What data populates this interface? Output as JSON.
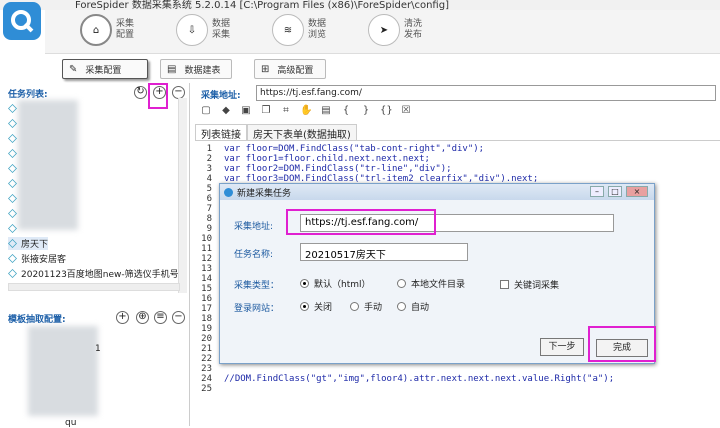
{
  "window": {
    "title": "ForeSpider 数据采集系统  5.2.0.14   [C:\\Program Files (x86)\\ForeSpider\\config]"
  },
  "top_tabs": [
    {
      "label": "采集\n配置",
      "icon": "home-icon"
    },
    {
      "label": "数据\n采集",
      "icon": "download-icon"
    },
    {
      "label": "数据\n浏览",
      "icon": "layers-icon"
    },
    {
      "label": "清洗\n发布",
      "icon": "send-icon"
    }
  ],
  "sub_tabs": [
    {
      "label": "采集配置"
    },
    {
      "label": "数据建表"
    },
    {
      "label": "高级配置"
    }
  ],
  "left": {
    "task_list_title": "任务列表:",
    "tasks": [
      "房天下",
      "张掖安居客",
      "20201123百度地图new-筛选仪手机号"
    ],
    "template_title": "模板抽取配置:",
    "tree_nodes": [
      "1",
      "qu"
    ]
  },
  "url_label": "采集地址:",
  "url_value": "https://tj.esf.fang.com/",
  "editor_tabs": [
    "列表链接",
    "房天下表单(数据抽取)"
  ],
  "code_lines": [
    "var floor=DOM.FindClass(\"tab-cont-right\",\"div\");",
    "var floor1=floor.child.next.next.next;",
    "var floor2=DOM.FindClass(\"tr-line\",\"div\");",
    "var floor3=DOM.FindClass(\"trl-item2 clearfix\",\"div\").next;"
  ],
  "code_line_bottom": "//DOM.FindClass(\"gt\",\"img\",floor4).attr.next.next.next.value.Right(\"a\");",
  "line_numbers": [
    "1",
    "2",
    "3",
    "4",
    "5",
    "6",
    "7",
    "8",
    "9",
    "10",
    "11",
    "12",
    "13",
    "14",
    "15",
    "16",
    "17",
    "18",
    "19",
    "20",
    "21",
    "22",
    "23",
    "24",
    "25"
  ],
  "dialog": {
    "title": "新建采集任务",
    "url_label": "采集地址:",
    "url_value": "https://tj.esf.fang.com/",
    "name_label": "任务名称:",
    "name_value": "20210517房天下",
    "type_label": "采集类型：",
    "type_options": [
      "默认（html）",
      "本地文件目录",
      "关键词采集"
    ],
    "login_label": "登录网站：",
    "login_options": [
      "关闭",
      "手动",
      "自动"
    ],
    "next_label": "下一步",
    "finish_label": "完成"
  },
  "colors": {
    "highlight": "#e020d0",
    "accent": "#2f8dd6"
  }
}
